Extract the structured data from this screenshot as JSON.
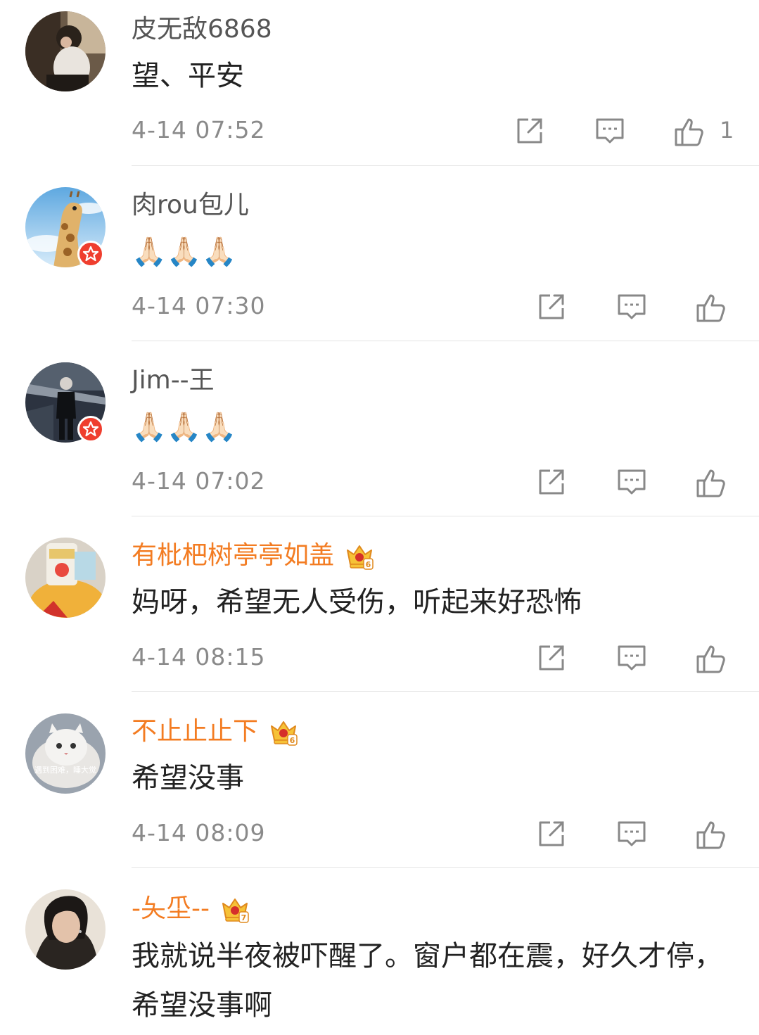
{
  "comments": [
    {
      "username": "皮无敌6868",
      "vip": false,
      "verified": false,
      "text": "望、平安",
      "time": "4-14 07:52",
      "like_count": "1",
      "avatar": "avatar-photo-woman"
    },
    {
      "username": "肉rou包儿",
      "vip": false,
      "verified": true,
      "text": "🙏🏻🙏🏻🙏🏻",
      "time": "4-14 07:30",
      "like_count": "",
      "avatar": "avatar-giraffe"
    },
    {
      "username": "Jim--王",
      "vip": false,
      "verified": true,
      "text": "🙏🏻🙏🏻🙏🏻",
      "time": "4-14 07:02",
      "like_count": "",
      "avatar": "avatar-man-dark"
    },
    {
      "username": "有枇杷树亭亭如盖",
      "vip": true,
      "vip_level": "6",
      "verified": false,
      "text": "妈呀，希望无人受伤，听起来好恐怖",
      "time": "4-14 08:15",
      "like_count": "",
      "avatar": "avatar-winnie"
    },
    {
      "username": "不止止止下",
      "vip": true,
      "vip_level": "6",
      "verified": false,
      "text": "希望没事",
      "time": "4-14 08:09",
      "like_count": "",
      "avatar": "avatar-cat",
      "avatar_caption": "遇到困难，睡大觉"
    },
    {
      "username": "-夨坕--",
      "vip": true,
      "vip_level": "7",
      "verified": false,
      "text": "我就说半夜被吓醒了。窗户都在震，好久才停，希望没事啊",
      "time": "",
      "like_count": "",
      "avatar": "avatar-girl-short-hair"
    }
  ],
  "icons": {
    "repost": "repost-icon",
    "reply": "comment-icon",
    "like": "thumbs-up-icon"
  },
  "colors": {
    "vip_name": "#f37c22",
    "normal_name": "#555555",
    "meta_text": "#8a8a8a",
    "divider": "#e4e4e4",
    "verified_badge": "#ef3e2e"
  }
}
